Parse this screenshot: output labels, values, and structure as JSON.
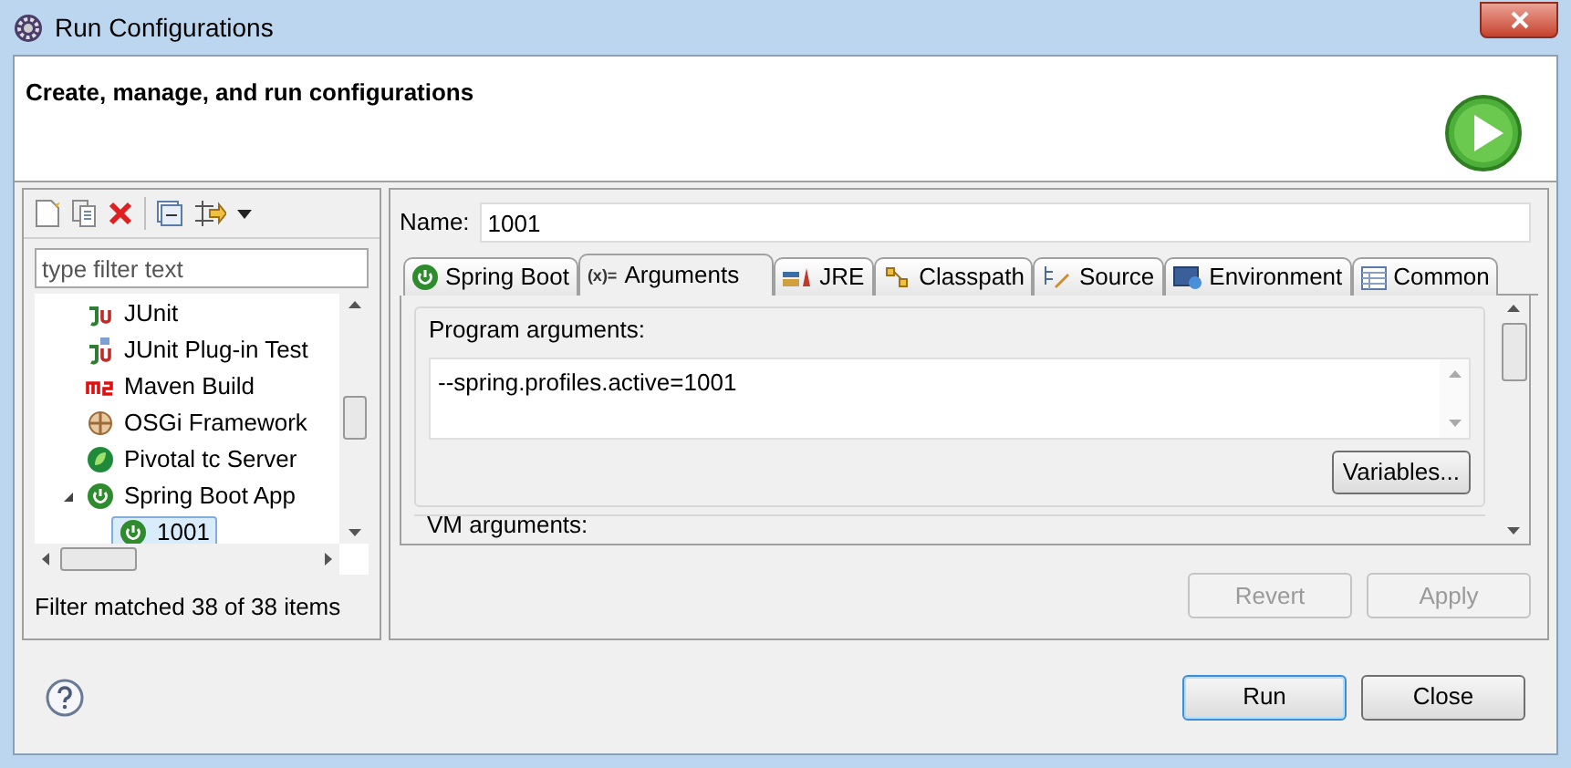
{
  "window": {
    "title": "Run Configurations"
  },
  "header": {
    "title": "Create, manage, and run configurations"
  },
  "filter": {
    "placeholder": "type filter text"
  },
  "tree": {
    "items": [
      {
        "label": "JUnit",
        "kind": "junit",
        "selected": false
      },
      {
        "label": "JUnit Plug-in Test",
        "kind": "junit-plugin",
        "selected": false
      },
      {
        "label": "Maven Build",
        "kind": "maven",
        "selected": false
      },
      {
        "label": "OSGi Framework",
        "kind": "osgi",
        "selected": false
      },
      {
        "label": "Pivotal tc Server",
        "kind": "pivotal",
        "selected": false
      },
      {
        "label": "Spring Boot App",
        "kind": "spring",
        "selected": false,
        "expanded": true,
        "children": [
          {
            "label": "1001",
            "kind": "spring",
            "selected": true
          }
        ]
      }
    ]
  },
  "filter_status": "Filter matched 38 of 38 items",
  "name": {
    "label": "Name:",
    "value": "1001"
  },
  "tabs": [
    {
      "label": "Spring Boot",
      "kind": "spring",
      "selected": false
    },
    {
      "label": "Arguments",
      "kind": "args",
      "icon_text": "(x)=",
      "selected": true
    },
    {
      "label": "JRE",
      "kind": "jre",
      "selected": false
    },
    {
      "label": "Classpath",
      "kind": "classpath",
      "selected": false
    },
    {
      "label": "Source",
      "kind": "source",
      "selected": false
    },
    {
      "label": "Environment",
      "kind": "env",
      "selected": false
    },
    {
      "label": "Common",
      "kind": "common",
      "selected": false
    }
  ],
  "program_arguments": {
    "label": "Program arguments:",
    "value": "--spring.profiles.active=1001",
    "button": "Variables..."
  },
  "vm_arguments": {
    "label": "VM arguments:"
  },
  "actions": [
    {
      "label": "Revert",
      "disabled": true
    },
    {
      "label": "Apply",
      "disabled": true
    }
  ],
  "buttons": [
    {
      "label": "Run",
      "default": true
    },
    {
      "label": "Close",
      "default": false
    }
  ]
}
